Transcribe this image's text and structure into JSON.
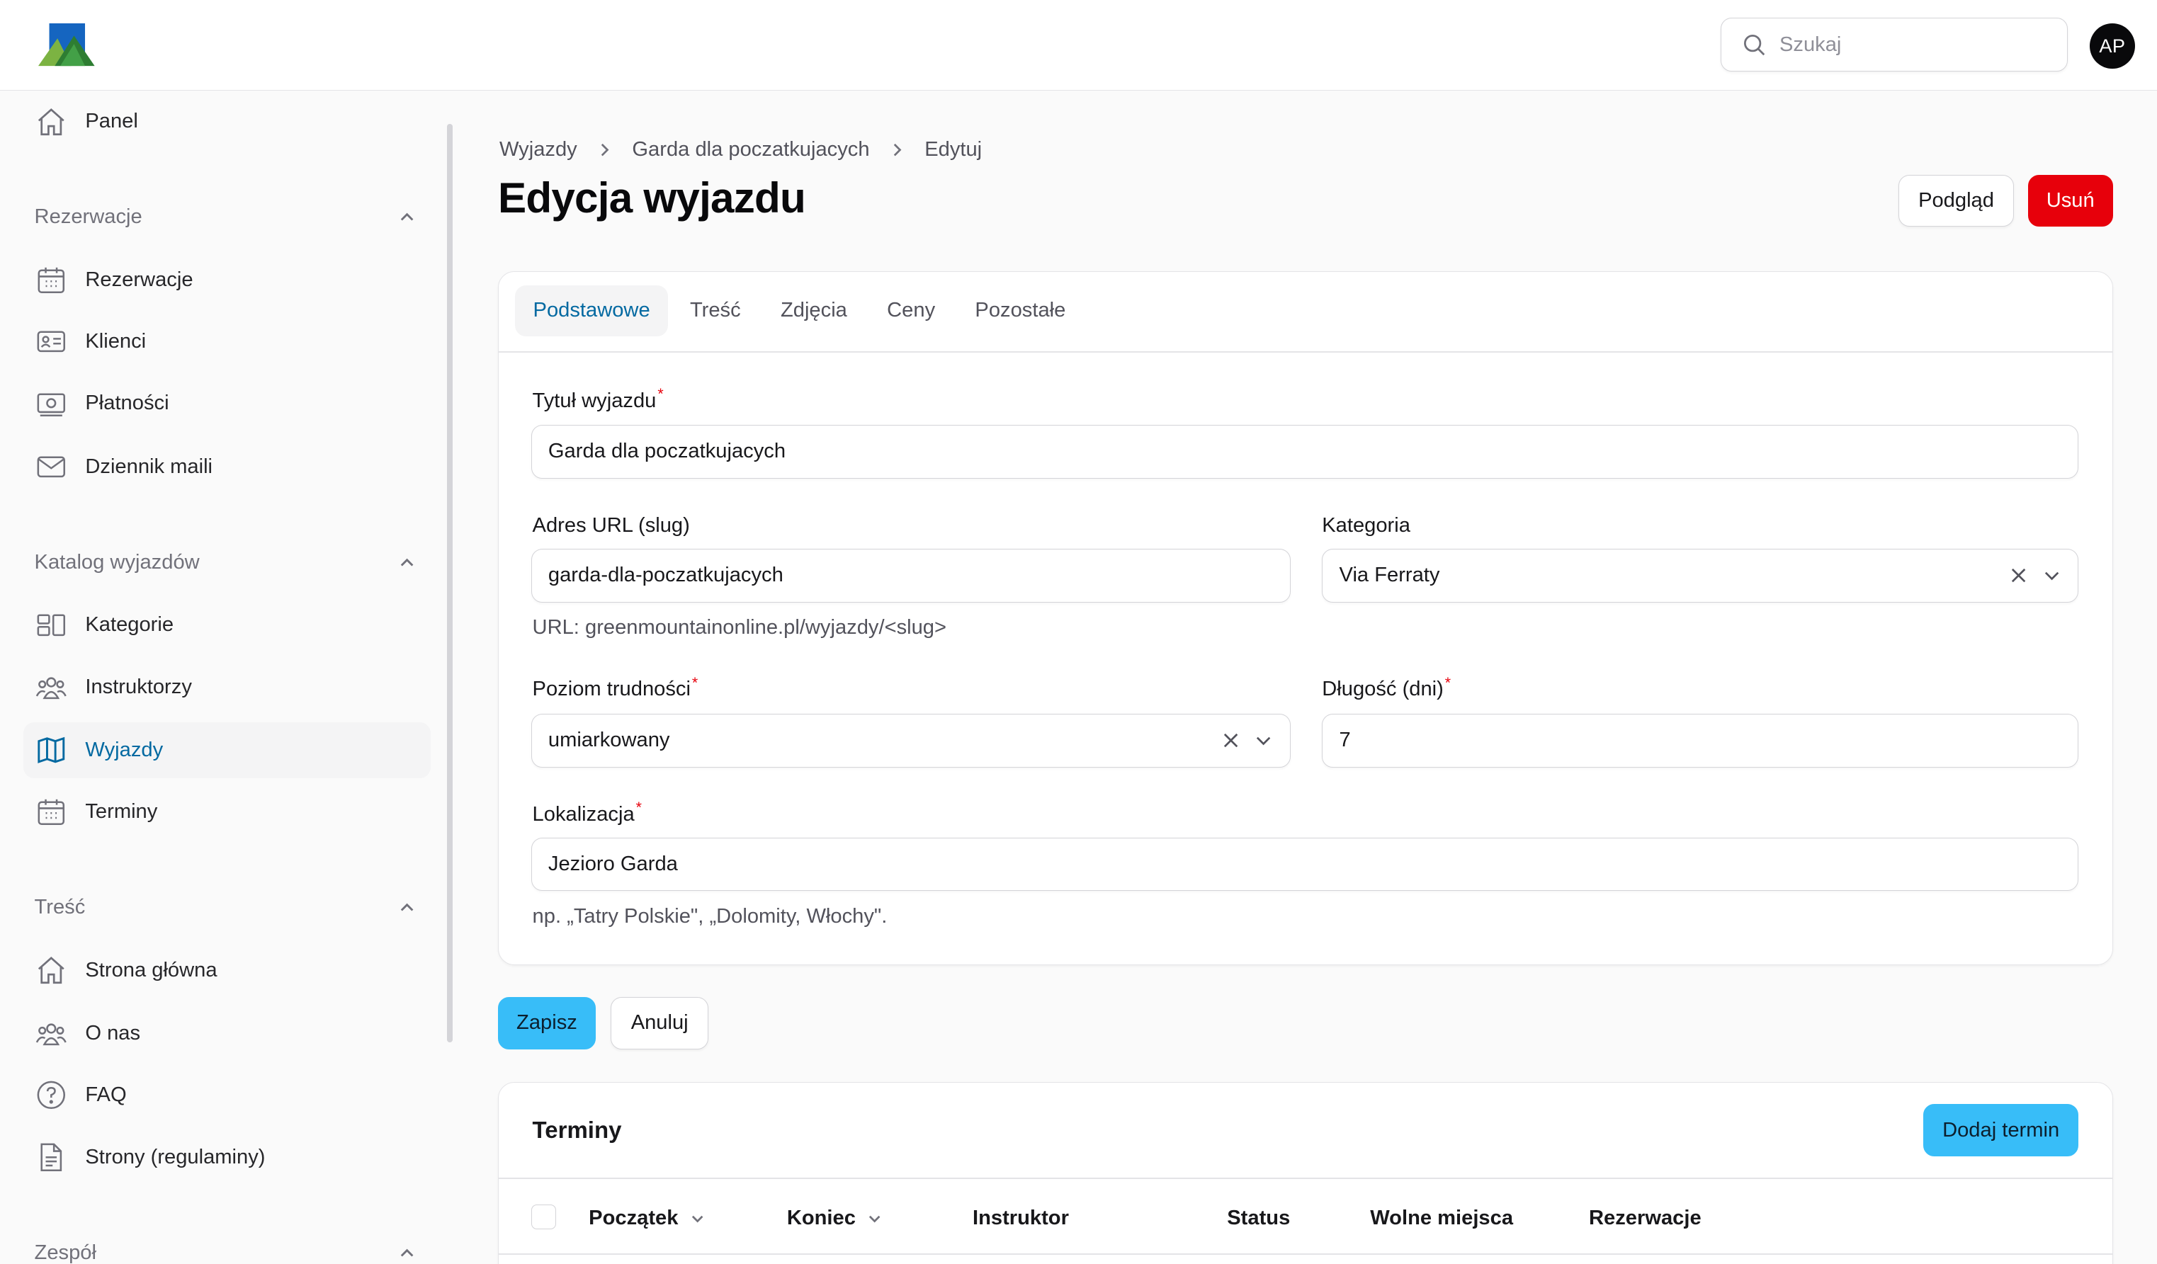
{
  "header": {
    "search_placeholder": "Szukaj",
    "avatar_initials": "AP"
  },
  "sidebar": {
    "panel": "Panel",
    "groups": [
      {
        "label": "Rezerwacje",
        "items": [
          "Rezerwacje",
          "Klienci",
          "Płatności",
          "Dziennik maili"
        ]
      },
      {
        "label": "Katalog wyjazdów",
        "items": [
          "Kategorie",
          "Instruktorzy",
          "Wyjazdy",
          "Terminy"
        ]
      },
      {
        "label": "Treść",
        "items": [
          "Strona główna",
          "O nas",
          "FAQ",
          "Strony (regulaminy)"
        ]
      },
      {
        "label": "Zespół",
        "items": []
      }
    ],
    "active_item": "Wyjazdy"
  },
  "breadcrumb": [
    "Wyjazdy",
    "Garda dla poczatkujacych",
    "Edytuj"
  ],
  "page": {
    "title": "Edycja wyjazdu",
    "preview_button": "Podgląd",
    "delete_button": "Usuń"
  },
  "tabs": [
    "Podstawowe",
    "Treść",
    "Zdjęcia",
    "Ceny",
    "Pozostałe"
  ],
  "form": {
    "title_label": "Tytuł wyjazdu",
    "title_value": "Garda dla poczatkujacych",
    "slug_label": "Adres URL (slug)",
    "slug_value": "garda-dla-poczatkujacych",
    "slug_hint": "URL: greenmountainonline.pl/wyjazdy/<slug>",
    "category_label": "Kategoria",
    "category_value": "Via Ferraty",
    "difficulty_label": "Poziom trudności",
    "difficulty_value": "umiarkowany",
    "duration_label": "Długość (dni)",
    "duration_value": "7",
    "location_label": "Lokalizacja",
    "location_value": "Jezioro Garda",
    "location_hint": "np. „Tatry Polskie\", „Dolomity, Włochy\".",
    "required_mark": "*"
  },
  "actions": {
    "save": "Zapisz",
    "cancel": "Anuluj"
  },
  "terms": {
    "title": "Terminy",
    "add_button": "Dodaj termin",
    "columns": [
      "Początek",
      "Koniec",
      "Instruktor",
      "Status",
      "Wolne miejsca",
      "Rezerwacje"
    ]
  },
  "colors": {
    "accent": "#0369a1",
    "primary_button": "#38bdf8",
    "danger": "#e7000b"
  }
}
